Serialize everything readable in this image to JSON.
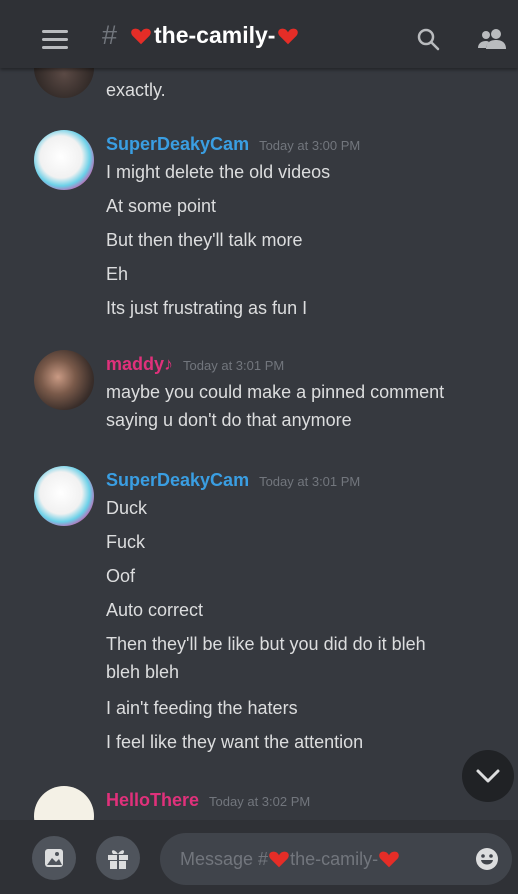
{
  "header": {
    "channel_name": "the-camily-",
    "colors": {
      "bar": "#2f3136",
      "heart": "#e52d27"
    }
  },
  "messages": [
    {
      "author": "",
      "lines": [
        "exactly."
      ],
      "avatar": "user-photo"
    },
    {
      "author": "SuperDeakyCam",
      "timestamp": "Today at 3:00 PM",
      "color": "#3a9ee2",
      "lines": [
        "I might delete the old videos",
        "At some point",
        "But then they'll talk more",
        "Eh",
        "Its just frustrating as fun I"
      ]
    },
    {
      "author": "maddy♪",
      "timestamp": "Today at 3:01 PM",
      "color": "#e0317b",
      "lines": [
        "maybe you could make a pinned comment",
        "saying u don't do that anymore"
      ]
    },
    {
      "author": "SuperDeakyCam",
      "timestamp": "Today at 3:01 PM",
      "color": "#3a9ee2",
      "lines": [
        "Duck",
        "Fuck",
        "Oof",
        "Auto correct",
        "Then they'll be like but you did do it bleh",
        "bleh bleh",
        "I ain't feeding the haters",
        "I feel like they want the attention"
      ]
    },
    {
      "author": "HelloThere",
      "timestamp": "Today at 3:02 PM",
      "color": "#e0317b",
      "lines": []
    }
  ],
  "composer": {
    "placeholder_prefix": "Message #",
    "placeholder_channel": "the-camily-"
  }
}
